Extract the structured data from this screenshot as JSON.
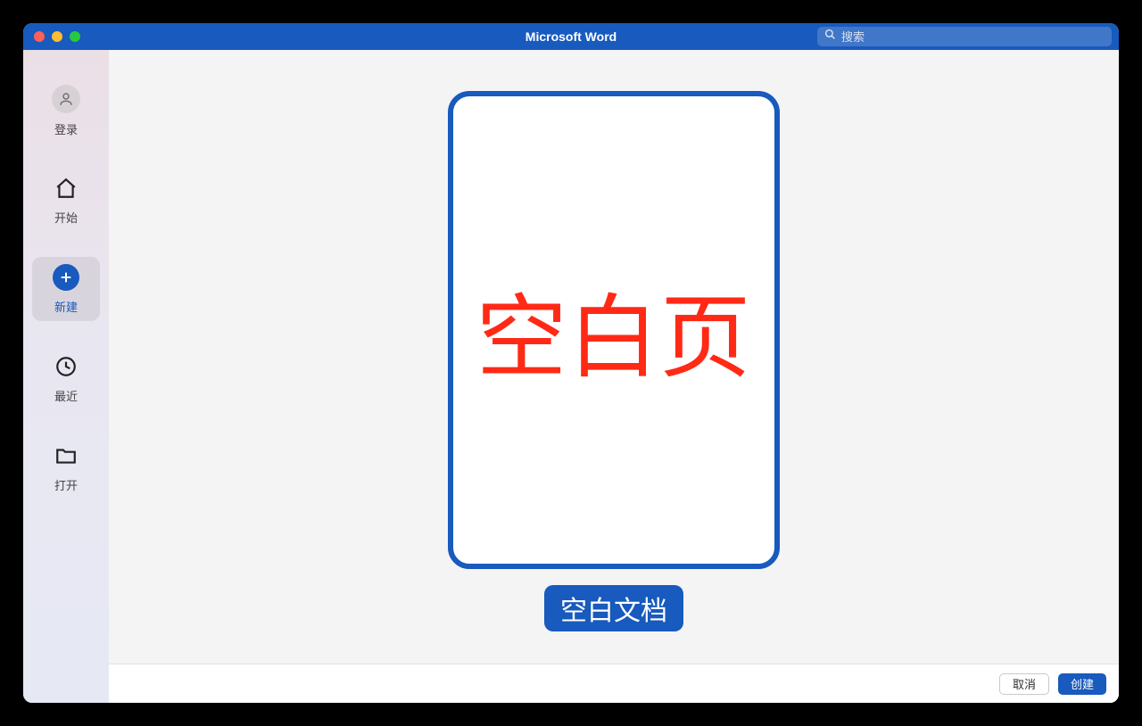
{
  "window": {
    "title": "Microsoft Word"
  },
  "search": {
    "placeholder": "搜索"
  },
  "sidebar": {
    "items": [
      {
        "icon": "person",
        "label": "登录"
      },
      {
        "icon": "home",
        "label": "开始"
      },
      {
        "icon": "plus",
        "label": "新建",
        "active": true
      },
      {
        "icon": "clock",
        "label": "最近"
      },
      {
        "icon": "folder",
        "label": "打开"
      }
    ]
  },
  "template": {
    "overlay_text": "空白页",
    "label": "空白文档"
  },
  "footer": {
    "cancel": "取消",
    "create": "创建"
  },
  "colors": {
    "brand": "#185ABD",
    "overlay_text": "#ff2a16"
  }
}
